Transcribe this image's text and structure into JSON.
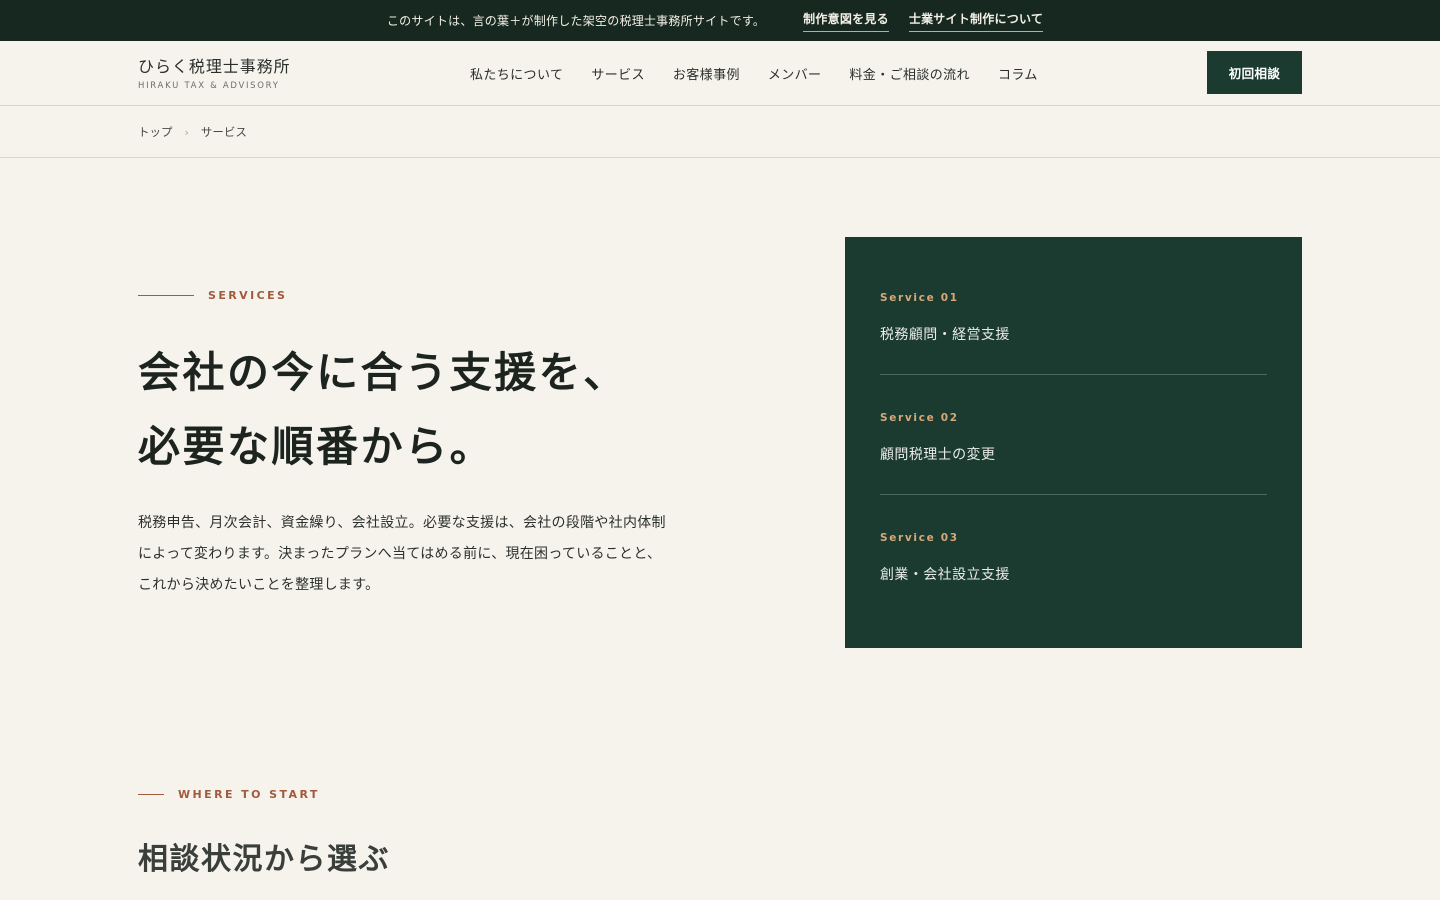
{
  "topbar": {
    "notice": "このサイトは、言の葉＋が制作した架空の税理士事務所サイトです。",
    "links": [
      "制作意図を見る",
      "士業サイト制作について"
    ]
  },
  "header": {
    "logo_ja": "ひらく税理士事務所",
    "logo_en": "HIRAKU TAX & ADVISORY",
    "nav": [
      "私たちについて",
      "サービス",
      "お客様事例",
      "メンバー",
      "料金・ご相談の流れ",
      "コラム"
    ],
    "cta_label": "初回相談"
  },
  "breadcrumb": {
    "items": [
      "トップ",
      "サービス"
    ],
    "separator": "›"
  },
  "services": {
    "eyebrow": "SERVICES",
    "heading_line1": "会社の今に合う支援を、",
    "heading_line2": "必要な順番から。",
    "lead_line1": "税務申告、月次会計、資金繰り、会社設立。必要な支援は、会社の段階や社内体制",
    "lead_line2": "によって変わります。決まったプランへ当てはめる前に、現在困っていることと、",
    "lead_line3": "これから決めたいことを整理します。",
    "items": [
      {
        "num": "Service 01",
        "name": "税務顧問・経営支援"
      },
      {
        "num": "Service 02",
        "name": "顧問税理士の変更"
      },
      {
        "num": "Service 03",
        "name": "創業・会社設立支援"
      }
    ]
  },
  "where_to_start": {
    "eyebrow": "WHERE TO START",
    "heading": "相談状況から選ぶ"
  },
  "colors": {
    "topbar_bg": "#16281f",
    "accent_green": "#1b3a30",
    "accent_rust": "#a25a3d",
    "page_bg": "#f6f3ed",
    "service_num": "#d8a878"
  }
}
